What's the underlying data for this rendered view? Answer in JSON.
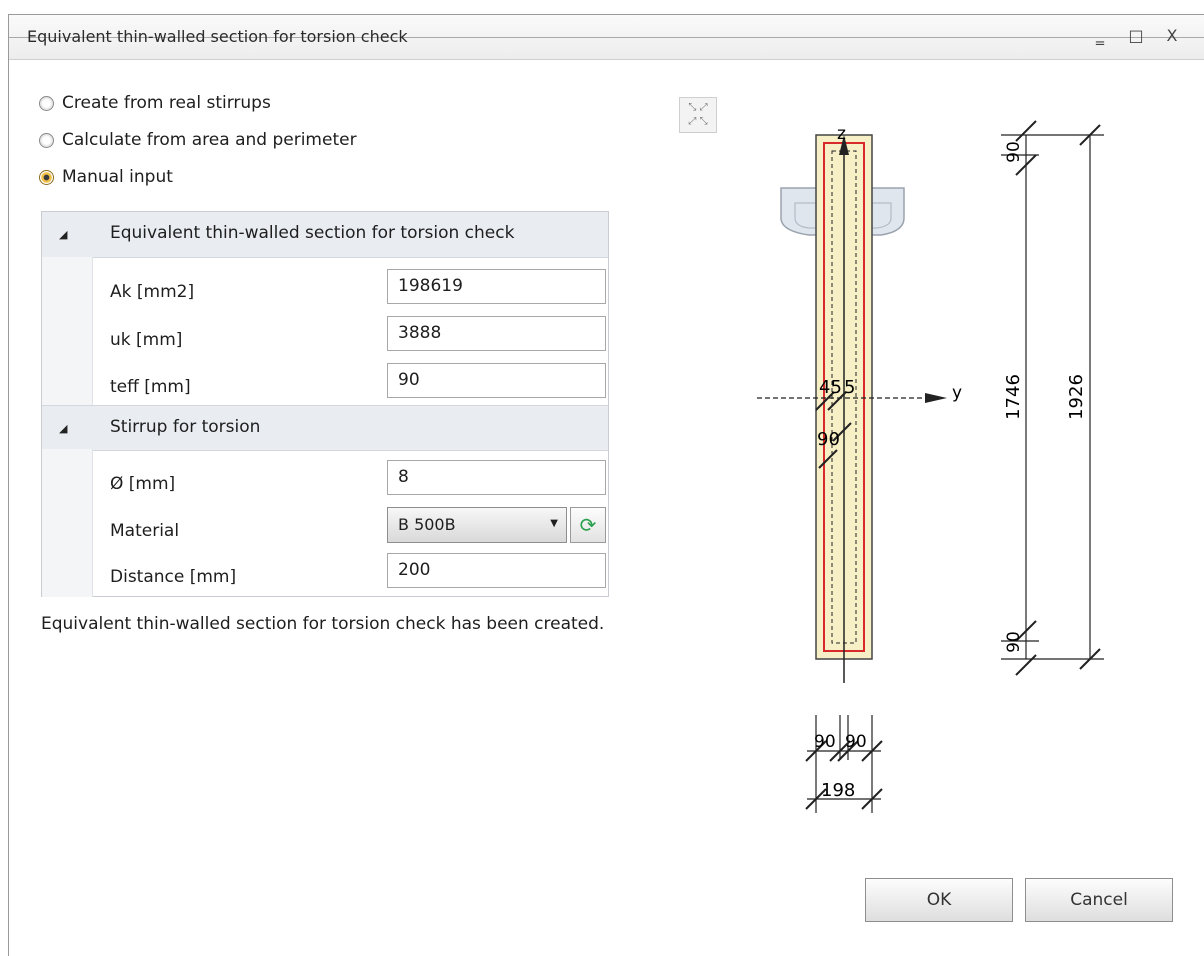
{
  "window": {
    "title": "Equivalent thin-walled section for torsion check",
    "controls": {
      "minimize": "‗",
      "maximize": "□",
      "close": "X"
    }
  },
  "options": [
    {
      "label": "Create from real stirrups",
      "checked": false
    },
    {
      "label": "Calculate from area and perimeter",
      "checked": false
    },
    {
      "label": "Manual input",
      "checked": true
    }
  ],
  "grid": {
    "section1": {
      "title": "Equivalent thin-walled section for torsion check",
      "rows": [
        {
          "label": "Ak [mm2]",
          "value": "198619"
        },
        {
          "label": "uk [mm]",
          "value": "3888"
        },
        {
          "label": "teff [mm]",
          "value": "90"
        }
      ]
    },
    "section2": {
      "title": "Stirrup for torsion",
      "rows": [
        {
          "label": "Ø [mm]",
          "value": "8"
        },
        {
          "label": "Material",
          "value": "B 500B"
        },
        {
          "label": "Distance [mm]",
          "value": "200"
        }
      ]
    }
  },
  "status_message": "Equivalent thin-walled section for torsion check  has been created.",
  "drawing": {
    "axis_z": "z",
    "axis_y": "y",
    "dim_top_90": "90",
    "dim_bottom_90": "90",
    "dim_1746": "1746",
    "dim_1926": "1926",
    "dim_45": "45",
    "dim_inner_90": "90",
    "dim_width_90a": "90",
    "dim_width_90b": "90",
    "dim_198": "198"
  },
  "buttons": {
    "ok": "OK",
    "cancel": "Cancel"
  }
}
